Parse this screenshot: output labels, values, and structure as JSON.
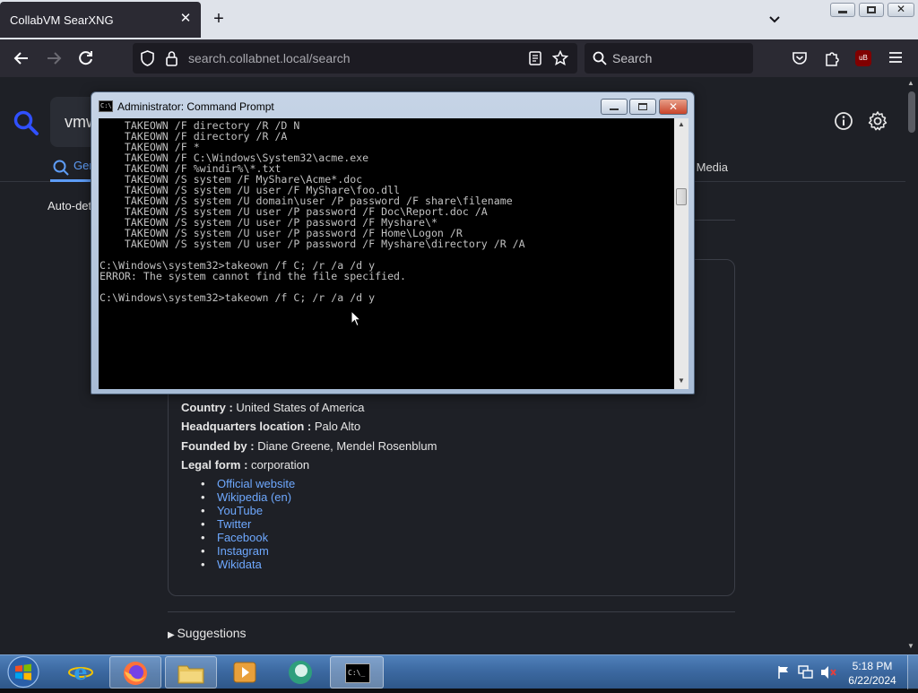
{
  "browser": {
    "tab_title": "CollabVM SearXNG",
    "url_host": "search.collabnet.local",
    "url_path": "/search",
    "search_placeholder": "Search",
    "ublock_badge": "uB"
  },
  "page": {
    "query_fragment": "vmw",
    "category_general": "Gen",
    "category_social": "ial Media",
    "auto_detect": "Auto-det",
    "infobox": {
      "country_label": "Country :",
      "country_value": "United States of America",
      "hq_label": "Headquarters location :",
      "hq_value": "Palo Alto",
      "founded_label": "Founded by :",
      "founded_value": "Diane Greene, Mendel Rosenblum",
      "legal_label": "Legal form :",
      "legal_value": "corporation",
      "links": [
        "Official website",
        "Wikipedia (en)",
        "YouTube",
        "Twitter",
        "Facebook",
        "Instagram",
        "Wikidata"
      ]
    },
    "suggestions_label": "Suggestions"
  },
  "cmd": {
    "title": "Administrator: Command Prompt",
    "icon_text": "C:\\.",
    "lines": [
      "    TAKEOWN /F directory /R /D N",
      "    TAKEOWN /F directory /R /A",
      "    TAKEOWN /F *",
      "    TAKEOWN /F C:\\Windows\\System32\\acme.exe",
      "    TAKEOWN /F %windir%\\*.txt",
      "    TAKEOWN /S system /F MyShare\\Acme*.doc",
      "    TAKEOWN /S system /U user /F MyShare\\foo.dll",
      "    TAKEOWN /S system /U domain\\user /P password /F share\\filename",
      "    TAKEOWN /S system /U user /P password /F Doc\\Report.doc /A",
      "    TAKEOWN /S system /U user /P password /F Myshare\\*",
      "    TAKEOWN /S system /U user /P password /F Home\\Logon /R",
      "    TAKEOWN /S system /U user /P password /F Myshare\\directory /R /A",
      "",
      "C:\\Windows\\system32>takeown /f C; /r /a /d y",
      "ERROR: The system cannot find the file specified.",
      "",
      "C:\\Windows\\system32>takeown /f C; /r /a /d y"
    ]
  },
  "taskbar": {
    "clock_time": "5:18 PM",
    "clock_date": "6/22/2024",
    "cmd_button_text": "C:\\_"
  }
}
